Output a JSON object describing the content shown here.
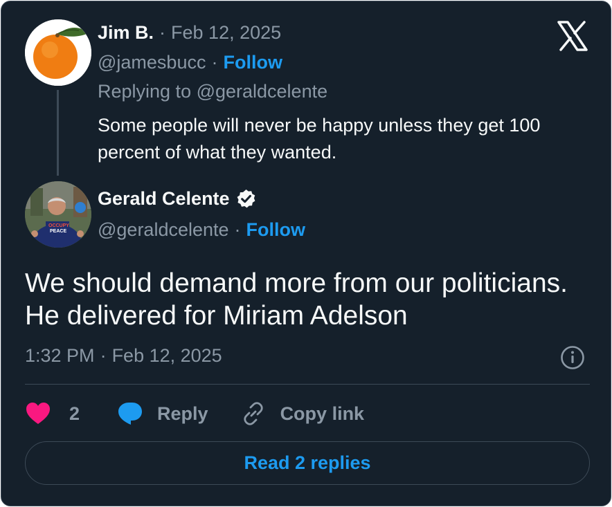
{
  "colors": {
    "background": "#15202b",
    "text_primary": "#f7f9f9",
    "text_muted": "#8b98a5",
    "accent_blue": "#1d9bf0",
    "like_pink": "#f91880",
    "border": "#3d4a57"
  },
  "icons": {
    "close": "x-logo-icon",
    "verified": "verified-badge-icon",
    "info": "info-icon",
    "like": "heart-icon",
    "reply": "speech-bubble-icon",
    "copy_link": "link-icon"
  },
  "parent_tweet": {
    "author_name": "Jim B.",
    "separator": "·",
    "date": "Feb 12, 2025",
    "handle": "@jamesbucc",
    "follow_label": "Follow",
    "replying_to": "Replying to @geraldcelente",
    "text": "Some people will never be happy unless they get 100 percent of what they wanted."
  },
  "main_tweet": {
    "author_name": "Gerald Celente",
    "handle": "@geraldcelente",
    "separator": "·",
    "follow_label": "Follow",
    "text_line1": "We should demand more from our politicians.",
    "text_line2": "He delivered for Miriam Adelson",
    "time": "1:32 PM",
    "date": "Feb 12, 2025"
  },
  "actions": {
    "like_count": "2",
    "reply_label": "Reply",
    "copy_link_label": "Copy link"
  },
  "read_replies_label": "Read 2 replies"
}
